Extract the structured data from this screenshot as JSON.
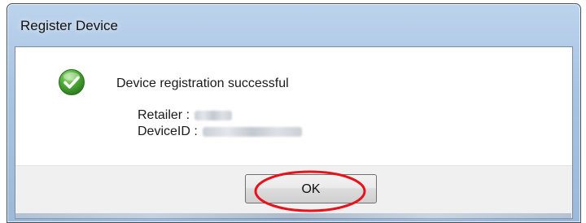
{
  "dialog": {
    "title": "Register Device",
    "message": "Device registration successful",
    "icon": "success-check-icon",
    "retailer_label": "Retailer :",
    "device_id_label": "DeviceID :",
    "ok_label": "OK"
  },
  "colors": {
    "annotation_ellipse": "#e8121a",
    "success_icon": "#4aa833"
  }
}
